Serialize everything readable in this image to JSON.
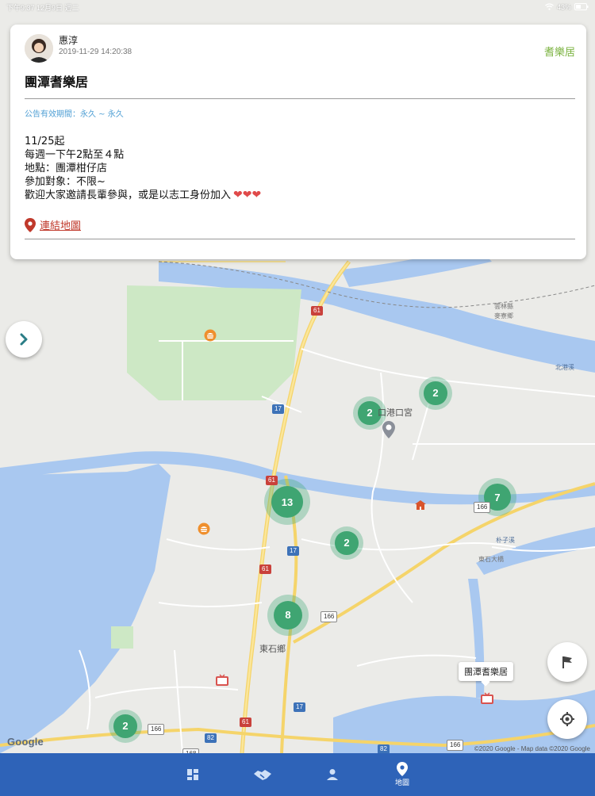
{
  "status_bar": {
    "left": "下午9:37  12月9日 週二",
    "right": "43%"
  },
  "card": {
    "author_name": "惠淳",
    "post_time": "2019-11-29 14:20:38",
    "group_tag": "耆樂居",
    "title": "團潭耆樂居",
    "validity": "公告有效期間：永久 ~ 永久",
    "body": [
      "11/25起",
      "每週一下午2點至４點",
      "地點：團潭柑仔店",
      "參加對象：不限~",
      "歡迎大家邀請長輩參與，或是以志工身份加入"
    ],
    "hearts": "❤❤❤",
    "map_link": "連結地圖"
  },
  "map": {
    "clusters": [
      "2",
      "2",
      "13",
      "7",
      "2",
      "8",
      "2"
    ],
    "labels": {
      "town": "東石鄉",
      "village": "口港口宮",
      "place_callout": "團潭耆樂居"
    },
    "small_labels": [
      "北港溪",
      "雲林縣",
      "麥寮鄉",
      "朴子溪",
      "東石大橋"
    ],
    "shields": [
      "61",
      "17",
      "61",
      "17",
      "61",
      "17",
      "61",
      "82",
      "82",
      "166",
      "166",
      "166",
      "166",
      "168"
    ],
    "google_logo": "Google",
    "attribution": "©2020 Google - Map data ©2020 Google"
  },
  "nav": {
    "active_label": "地圖"
  },
  "colors": {
    "nav_bg": "#2e63b8",
    "cluster": "#3fa572",
    "group_tag": "#7cb342",
    "link": "#c0392b",
    "validity": "#4f9fd4"
  }
}
